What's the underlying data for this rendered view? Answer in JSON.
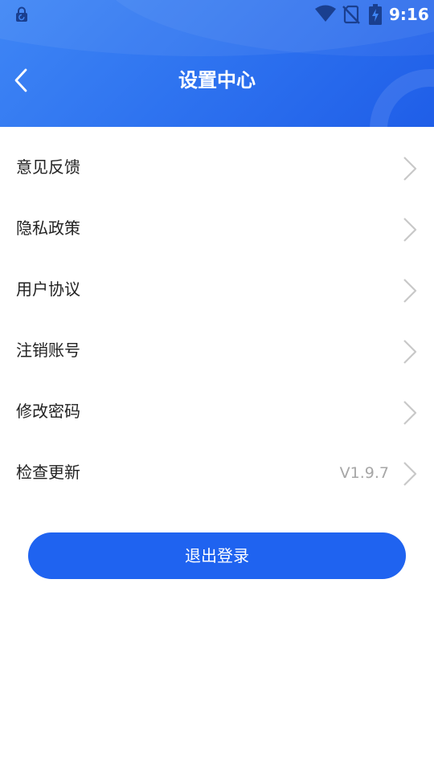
{
  "status_bar": {
    "time": "9:16",
    "icons": [
      "lock-icon",
      "wifi-icon",
      "no-sim-icon",
      "battery-icon"
    ]
  },
  "header": {
    "title": "设置中心",
    "back_icon": "chevron-left-icon"
  },
  "menu": {
    "items": [
      {
        "label": "意见反馈",
        "value": ""
      },
      {
        "label": "隐私政策",
        "value": ""
      },
      {
        "label": "用户协议",
        "value": ""
      },
      {
        "label": "注销账号",
        "value": ""
      },
      {
        "label": "修改密码",
        "value": ""
      },
      {
        "label": "检查更新",
        "value": "V1.9.7"
      }
    ]
  },
  "logout": {
    "label": "退出登录"
  },
  "colors": {
    "header_gradient_start": "#3f86f5",
    "header_gradient_end": "#1f5ee8",
    "primary_button": "#1f63f0",
    "label_text": "#222222",
    "value_text": "#a6a6a6",
    "chevron": "#c8c8c8"
  }
}
